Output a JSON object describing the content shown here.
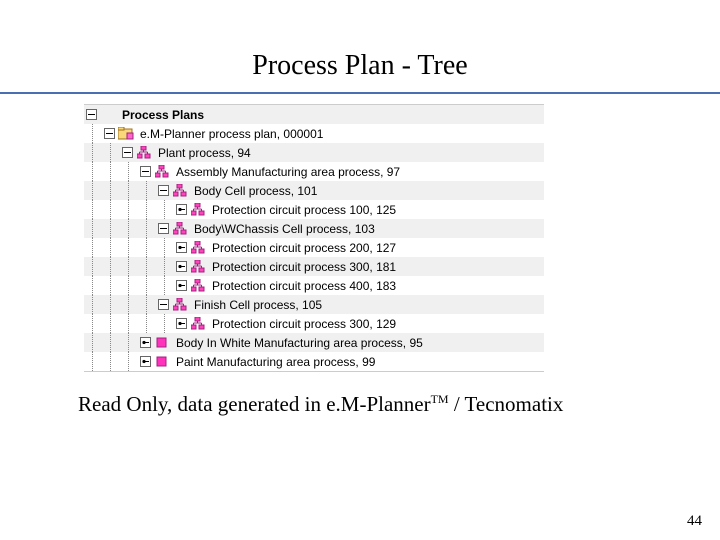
{
  "title": "Process Plan - Tree",
  "caption_pre": "Read Only, data generated in e.M-Planner",
  "caption_sup": "TM",
  "caption_post": " / Tecnomatix",
  "page_number": "44",
  "tree": {
    "root": "Process Plans",
    "nodes": [
      {
        "level": 1,
        "btn": "minus",
        "icon": "folder",
        "label": "e.M-Planner process plan, 000001"
      },
      {
        "level": 2,
        "btn": "minus",
        "icon": "proc",
        "label": "Plant process, 94"
      },
      {
        "level": 3,
        "btn": "minus",
        "icon": "proc",
        "label": "Assembly Manufacturing area process, 97"
      },
      {
        "level": 4,
        "btn": "minus",
        "icon": "proc",
        "label": "Body Cell process, 101"
      },
      {
        "level": 5,
        "btn": "key",
        "icon": "proc",
        "label": "Protection circuit process 100, 125"
      },
      {
        "level": 4,
        "btn": "minus",
        "icon": "proc",
        "label": "Body\\WChassis Cell process, 103"
      },
      {
        "level": 5,
        "btn": "key",
        "icon": "proc",
        "label": "Protection circuit process 200, 127"
      },
      {
        "level": 5,
        "btn": "key",
        "icon": "proc",
        "label": "Protection circuit process 300, 181"
      },
      {
        "level": 5,
        "btn": "key",
        "icon": "proc",
        "label": "Protection circuit process 400, 183"
      },
      {
        "level": 4,
        "btn": "minus",
        "icon": "proc",
        "label": "Finish Cell process, 105"
      },
      {
        "level": 5,
        "btn": "key",
        "icon": "proc",
        "label": "Protection circuit process 300, 129"
      },
      {
        "level": 3,
        "btn": "key",
        "icon": "box",
        "label": "Body In White Manufacturing area process, 95"
      },
      {
        "level": 3,
        "btn": "key",
        "icon": "box",
        "label": "Paint Manufacturing area process, 99"
      }
    ]
  }
}
